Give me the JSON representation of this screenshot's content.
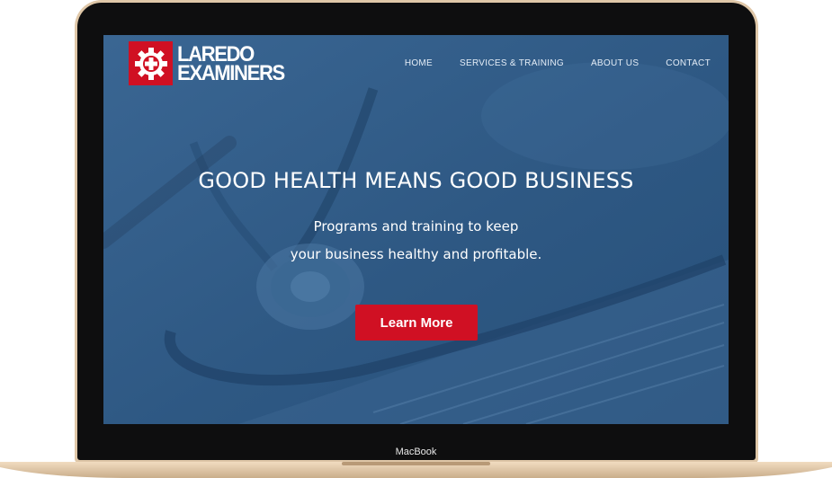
{
  "device": {
    "label": "MacBook"
  },
  "site": {
    "logo": {
      "line1": "LAREDO",
      "line2": "EXAMINERS",
      "icon": "gear-medical-cross-icon"
    },
    "nav": [
      {
        "label": "HOME"
      },
      {
        "label": "SERVICES & TRAINING"
      },
      {
        "label": "ABOUT US"
      },
      {
        "label": "CONTACT"
      }
    ],
    "hero": {
      "title": "GOOD HEALTH MEANS GOOD BUSINESS",
      "subtitle_line1": "Programs and training to keep",
      "subtitle_line2": "your business healthy and profitable.",
      "cta_label": "Learn More",
      "background": "stethoscope-on-medical-chart-image"
    }
  },
  "colors": {
    "brand_red": "#d01023",
    "hero_overlay": "#2f5984",
    "nav_text": "#e4edf7",
    "bezel": "#0e0e0f",
    "lid_gold": "#dfc7a8"
  }
}
